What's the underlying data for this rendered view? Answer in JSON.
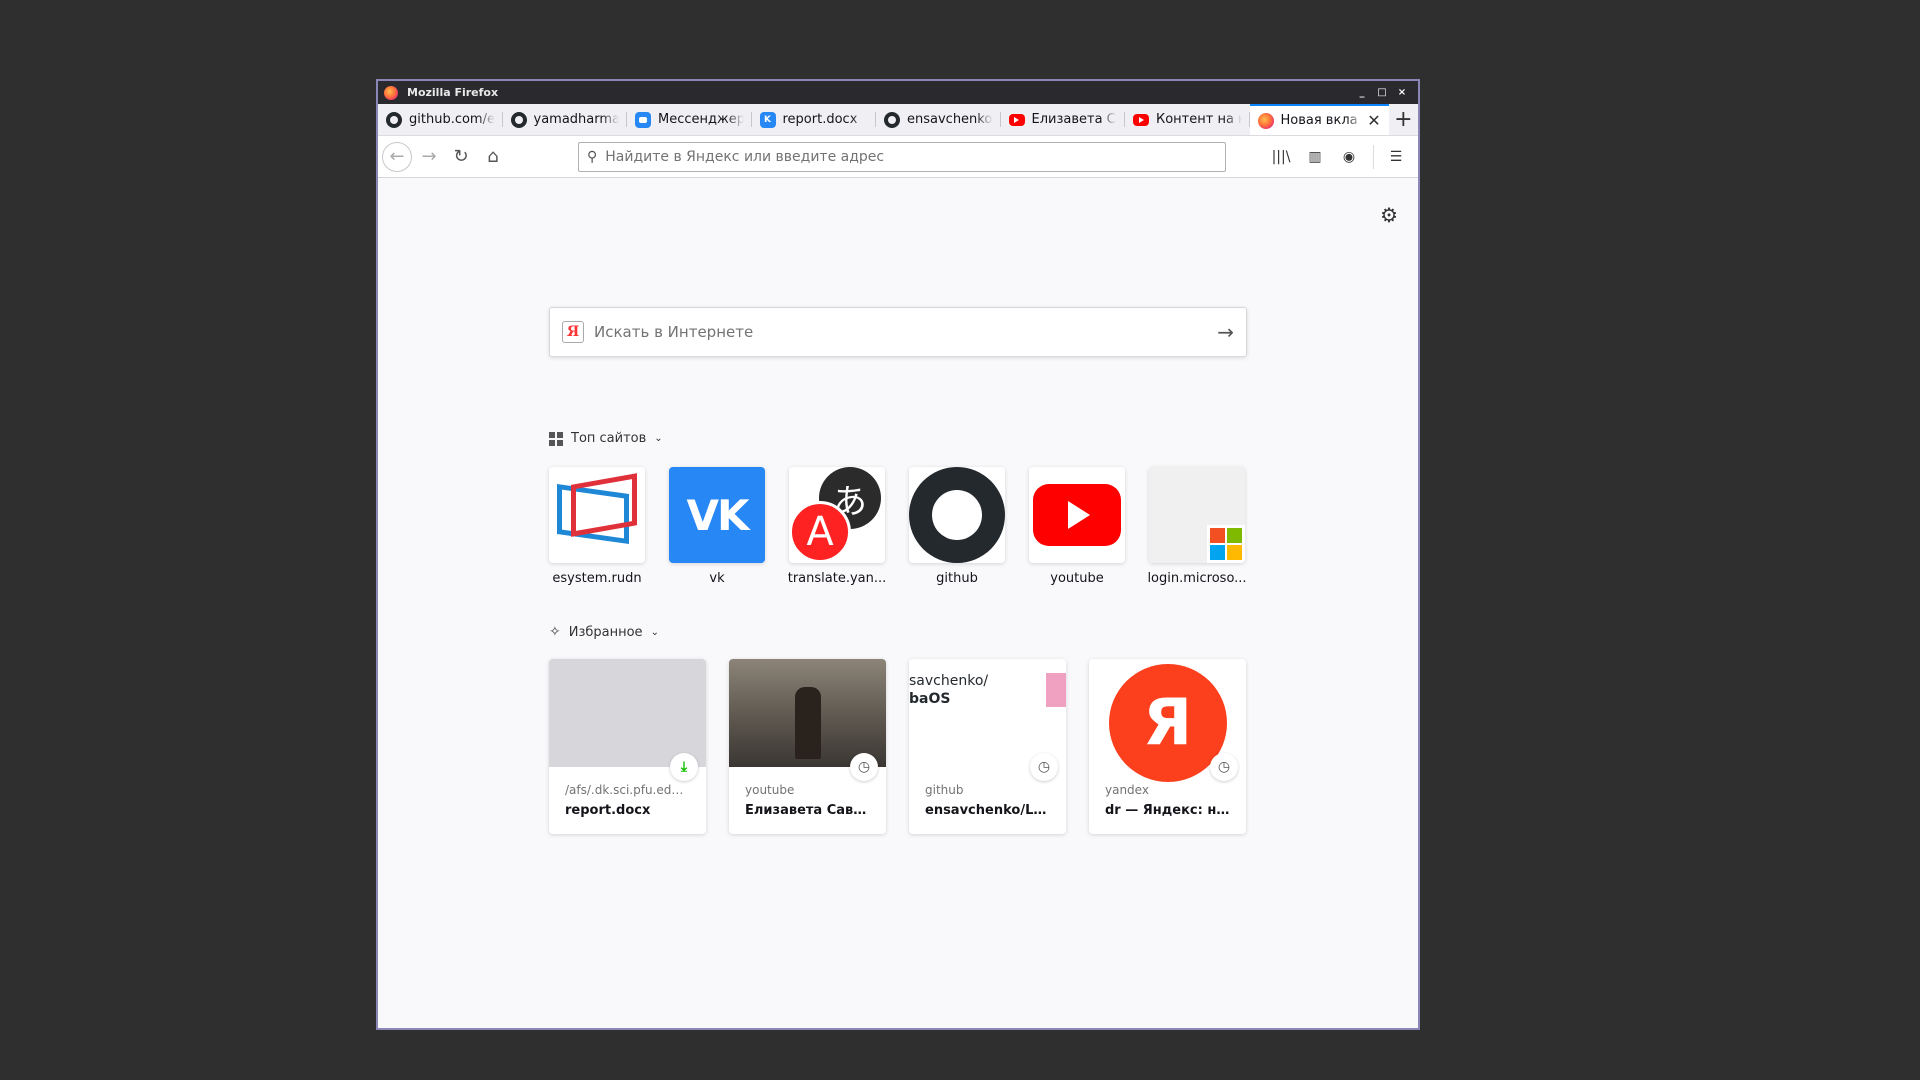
{
  "window": {
    "title": "Mozilla Firefox",
    "controls": [
      "_",
      "□",
      "×"
    ]
  },
  "tabs": [
    {
      "label": "github.com/e",
      "favicon": "github-icon"
    },
    {
      "label": "yamadharma",
      "favicon": "github-icon"
    },
    {
      "label": "Мессенджер",
      "favicon": "vk-messenger-icon"
    },
    {
      "label": "report.docx",
      "favicon": "vk-icon"
    },
    {
      "label": "ensavchenko/",
      "favicon": "github-icon"
    },
    {
      "label": "Елизавета Са",
      "favicon": "youtube-icon"
    },
    {
      "label": "Контент на к",
      "favicon": "youtube-icon"
    },
    {
      "label": "Новая вкла",
      "favicon": "firefox-icon",
      "active": true
    }
  ],
  "new_tab_glyph": "+",
  "urlbar": {
    "placeholder": "Найдите в Яндекс или введите адрес"
  },
  "search": {
    "placeholder": "Искать в Интернете",
    "engine_logo": "Я"
  },
  "top_sites": {
    "header": "Топ сайтов",
    "items": [
      {
        "label": "esystem.rudn"
      },
      {
        "label": "vk",
        "logo_text": "VK"
      },
      {
        "label": "translate.yan...",
        "logo_a": "A",
        "logo_ja": "あ"
      },
      {
        "label": "github"
      },
      {
        "label": "youtube"
      },
      {
        "label": "login.microso..."
      }
    ]
  },
  "highlights": {
    "header": "Избранное",
    "items": [
      {
        "source": "/afs/.dk.sci.pfu.edu....",
        "title": "report.docx",
        "badge": "download-icon"
      },
      {
        "source": "youtube",
        "title": "Елизавета Савче...",
        "badge": "history-icon"
      },
      {
        "source": "github",
        "title": "ensavchenko/Lab...",
        "badge": "history-icon",
        "thumb_line1": "savchenko/",
        "thumb_line2": "baOS"
      },
      {
        "source": "yandex",
        "title": "dr — Яндекс: на...",
        "badge": "history-icon",
        "thumb_logo": "Я"
      }
    ]
  },
  "colors": {
    "accent": "#0a84ff",
    "titlebar": "#2a2a2e",
    "youtube": "#ff0000",
    "vk": "#2787f5",
    "yandex": "#fc3f1d"
  }
}
